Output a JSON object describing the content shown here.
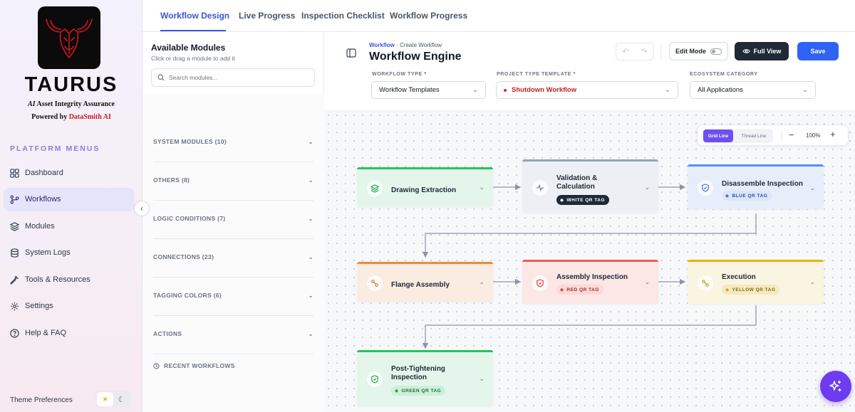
{
  "brand": {
    "name": "TAURUS",
    "tagline_ai": "AI",
    "tagline_rest": "Asset Integrity Assurance",
    "powered_prefix": "Powered by",
    "powered_name": "DataSmith AI"
  },
  "sidebar": {
    "header": "PLATFORM MENUS",
    "items": [
      {
        "label": "Dashboard",
        "icon": "grid-icon"
      },
      {
        "label": "Workflows",
        "icon": "branch-icon",
        "active": true
      },
      {
        "label": "Modules",
        "icon": "layers-icon"
      },
      {
        "label": "System Logs",
        "icon": "database-icon"
      },
      {
        "label": "Tools & Resources",
        "icon": "wrench-icon"
      },
      {
        "label": "Settings",
        "icon": "gear-icon"
      },
      {
        "label": "Help & FAQ",
        "icon": "question-icon"
      }
    ],
    "theme_label": "Theme Preferences"
  },
  "tabs": [
    "Workflow Design",
    "Live Progress",
    "Inspection Checklist",
    "Workflow Progress"
  ],
  "modules_panel": {
    "title": "Available Modules",
    "subtitle": "Click or drag a module to add it",
    "search_placeholder": "Search modules...",
    "sections": [
      "SYSTEM MODULES (10)",
      "OTHERS (8)",
      "LOGIC CONDITIONS (7)",
      "CONNECTIONS (23)",
      "TAGGING COLORS (6)",
      "ACTIONS"
    ],
    "recent": "RECENT WORKFLOWS"
  },
  "header": {
    "breadcrumb_root": "Workflow",
    "breadcrumb_sep": "›",
    "breadcrumb_current": "Create Workflow",
    "title": "Workflow Engine",
    "edit_mode": "Edit Mode",
    "full_view": "Full View",
    "save": "Save"
  },
  "fields": {
    "workflow_type": {
      "label": "WORKFLOW TYPE",
      "value": "Workflow Templates",
      "required": "*"
    },
    "project_template": {
      "label": "PROJECT TYPE TEMPLATE",
      "value": "Shutdown Workflow",
      "required": "*"
    },
    "ecosystem": {
      "label": "ECOSYSTEM CATEGORY",
      "value": "All Applications"
    }
  },
  "canvas_toolbar": {
    "grid_line": "Grid Line",
    "thread_line": "Thread Line",
    "zoom": "100%"
  },
  "nodes": [
    {
      "title": "Drawing Extraction",
      "accent": "#22c55e",
      "bg": "#e4f6ec"
    },
    {
      "title": "Validation & Calculation",
      "accent": "#94a3b8",
      "bg": "#eceff3",
      "tag": "WHITE QR TAG"
    },
    {
      "title": "Disassemble Inspection",
      "accent": "#5b8def",
      "bg": "#e6eefc",
      "tag": "BLUE QR TAG"
    },
    {
      "title": "Flange Assembly",
      "accent": "#f08a3a",
      "bg": "#fbece2"
    },
    {
      "title": "Assembly Inspection",
      "accent": "#ef5b57",
      "bg": "#fbe7e6",
      "tag": "RED QR TAG"
    },
    {
      "title": "Execution",
      "accent": "#eab308",
      "bg": "#faf5e1",
      "tag": "YELLOW QR TAG"
    },
    {
      "title": "Post-Tightening Inspection",
      "accent": "#22c55e",
      "bg": "#e4f6ec",
      "tag": "GREEN QR TAG"
    }
  ],
  "colors": {
    "primary": "#3b56d6",
    "save": "#2f63f2",
    "fab": "#6d3bf0"
  }
}
